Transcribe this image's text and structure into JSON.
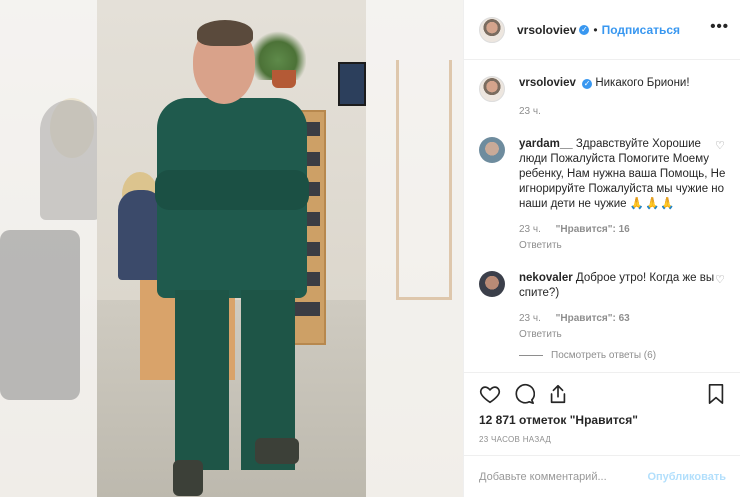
{
  "header": {
    "username": "vrsoloviev",
    "dot": "•",
    "follow_label": "Подписаться",
    "more_label": "•••"
  },
  "caption": {
    "username": "vrsoloviev",
    "text": "Никакого Бриони!",
    "time": "23 ч."
  },
  "comments": [
    {
      "username": "yardam__",
      "text": "Здравствуйте Хорошие люди Пожалуйста Помогите Моему ребенку, Нам нужна ваша Помощь, Не игнорируйте Пожалуйста мы чужие но наши дети не чужие",
      "emoji": "🙏🙏🙏",
      "time": "23 ч.",
      "likes": "\"Нравится\": 16",
      "reply": "Ответить"
    },
    {
      "username": "nekovaler",
      "text": "Доброе утро! Когда же вы спите?)",
      "time": "23 ч.",
      "likes": "\"Нравится\": 63",
      "reply": "Ответить",
      "view_replies": "Посмотреть ответы (6)"
    }
  ],
  "post": {
    "likes": "12 871 отметок \"Нравится\"",
    "timestamp": "23 ЧАСОВ НАЗАД"
  },
  "add_comment": {
    "placeholder": "Добавьте комментарий...",
    "publish_label": "Опубликовать"
  },
  "icons": {
    "like": "heart-icon",
    "comment": "comment-icon",
    "share": "share-icon",
    "save": "bookmark-icon",
    "verified": "verified-badge-icon"
  },
  "colors": {
    "accent": "#3897f0",
    "publish_disabled": "#b2dffc",
    "muted": "#8e8e8e"
  }
}
